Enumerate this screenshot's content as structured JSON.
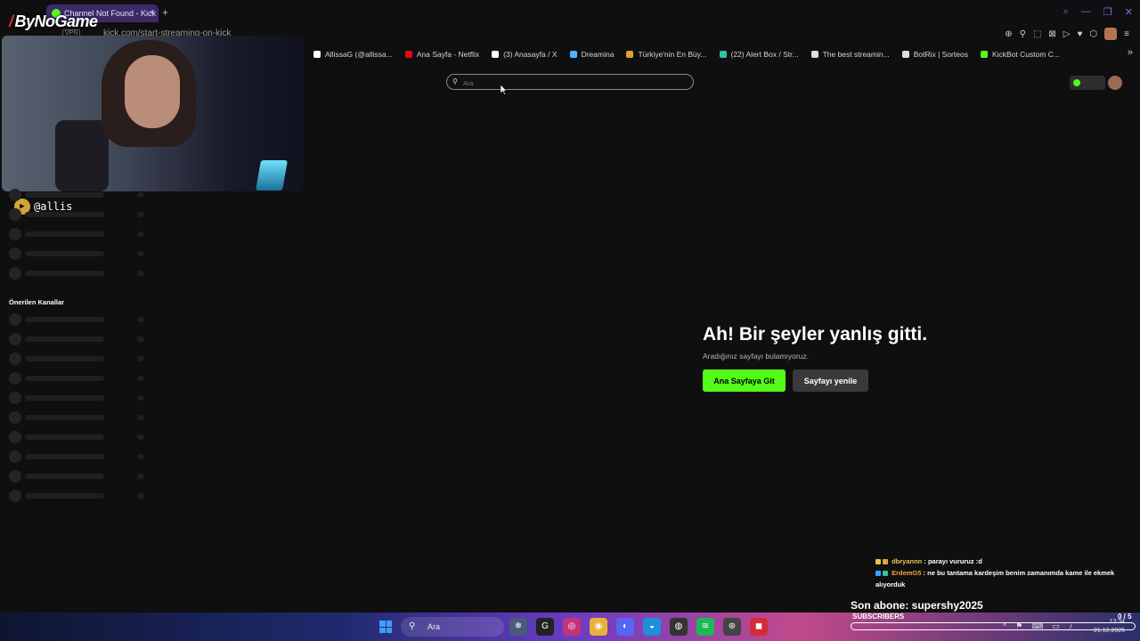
{
  "browser": {
    "tab_title": "Channel Not Found - Kick",
    "tab_close": "×",
    "new_tab": "+",
    "vpn_label": "VPN",
    "url": "kick.com/start-streaming-on-kick",
    "window_controls": [
      "⌕",
      "—",
      "❐",
      "✕"
    ],
    "extension_icons": [
      "⊕",
      "⚲",
      "⬚",
      "⊠",
      "▷",
      "♥",
      "⬡",
      "≡"
    ]
  },
  "overlay_logo": "ByNoGame",
  "bookmarks": [
    {
      "label": "AllissaG (@allissa...",
      "icon": "tiktok-icon",
      "color": "#ffffff"
    },
    {
      "label": "Ana Sayfa - Netflix",
      "icon": "netflix-icon",
      "color": "#e50914"
    },
    {
      "label": "(3) Anasayfa / X",
      "icon": "x-icon",
      "color": "#ffffff"
    },
    {
      "label": "Dreamina",
      "icon": "dreamina-icon",
      "color": "#4fb3ff"
    },
    {
      "label": "Türkiye'nin En Büy...",
      "icon": "site-icon",
      "color": "#e0a030"
    },
    {
      "label": "(22) Alert Box / Str...",
      "icon": "streamlabs-icon",
      "color": "#31c3a2"
    },
    {
      "label": "The best streamin...",
      "icon": "site-icon",
      "color": "#dddddd"
    },
    {
      "label": "BotRix | Sorteos",
      "icon": "botrix-icon",
      "color": "#dddddd"
    },
    {
      "label": "KickBot Custom C...",
      "icon": "kickbot-icon",
      "color": "#53fc18"
    }
  ],
  "bookmarks_more": "»",
  "search": {
    "placeholder": "Ara"
  },
  "webcam": {
    "name": "@allis"
  },
  "sidebar": {
    "suggested_title": "Önerilen Kanallar"
  },
  "error": {
    "title": "Ah! Bir şeyler yanlış gitti.",
    "subtitle": "Aradığınız sayfayı bulamıyoruz.",
    "home_button": "Ana Sayfaya Git",
    "reload_button": "Sayfayı yenile"
  },
  "chat": [
    {
      "user": "dbryannn",
      "message": ": parayı vururuz :d"
    },
    {
      "user": "ErdemG5",
      "message": ": ne bu tantama kardeşim benim zamanımda kame ile ekmek alıyorduk"
    }
  ],
  "subscriber_goal": {
    "last_sub": "Son abone: supershy2025",
    "label": "SUBSCRIBERS",
    "count": "0 / 5",
    "progress": 0
  },
  "taskbar": {
    "search_placeholder": "Ara",
    "time": "13:34",
    "date": "21.12.2025"
  },
  "colors": {
    "kick_green": "#53fc18",
    "accent_purple": "#8a6bd8"
  }
}
